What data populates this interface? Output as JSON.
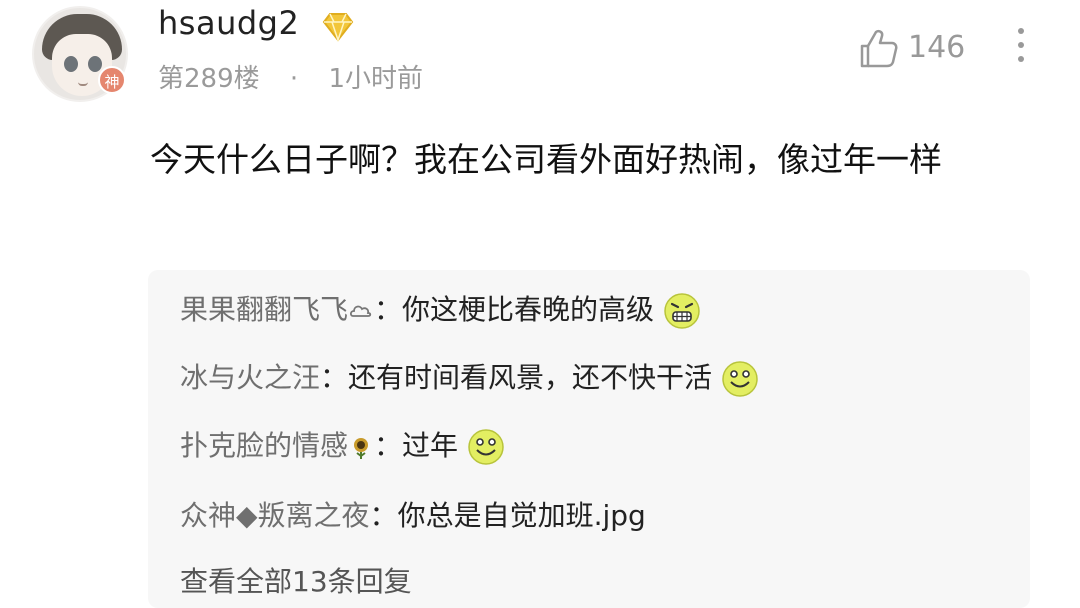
{
  "comment": {
    "username": "hsaudg2",
    "floor": "第289楼",
    "separator": "·",
    "time": "1小时前",
    "likes": "146",
    "avatar_badge": "神",
    "text": "今天什么日子啊？我在公司看外面好热闹，像过年一样"
  },
  "replies": [
    {
      "name": "果果翻翻飞飞",
      "name_suffix_icon": "cloud-icon",
      "colon": "：",
      "text": "你这梗比春晚的高级",
      "emoji": "grin-emoji"
    },
    {
      "name": "冰与火之汪",
      "colon": "：",
      "text": "还有时间看风景，还不快干活",
      "emoji": "smile-emoji"
    },
    {
      "name": "扑克脸的情感",
      "name_suffix_icon": "sunflower-icon",
      "colon": "：",
      "text": "过年",
      "emoji": "smile-emoji"
    },
    {
      "name": "众神◆叛离之夜",
      "colon": "：",
      "text": "你总是自觉加班.jpg"
    }
  ],
  "view_all": "查看全部13条回复",
  "colors": {
    "vip_gold": "#f2c63a",
    "avatar_badge": "#e5866e",
    "meta_gray": "#9a9a9a",
    "reply_bg": "#f7f7f7"
  }
}
